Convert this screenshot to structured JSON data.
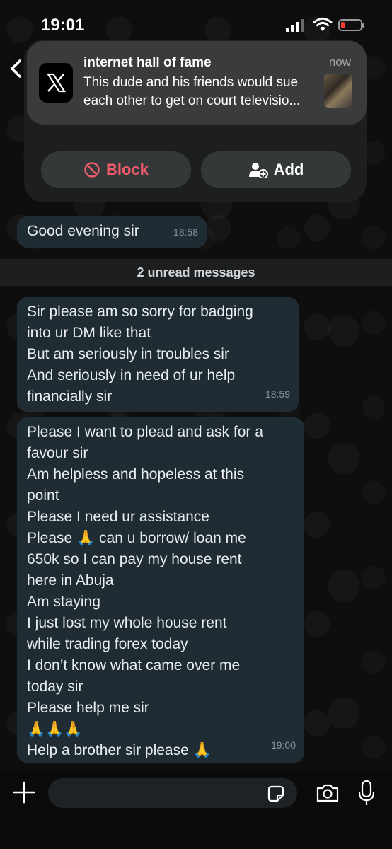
{
  "status_bar": {
    "time": "19:01",
    "battery_color": "#ff3b30"
  },
  "notification": {
    "app_icon": "x-logo-icon",
    "title": "internet hall of fame",
    "time": "now",
    "body_lines": [
      "This dude and his friends would sue",
      "each other to get on court televisio..."
    ]
  },
  "contact_actions": {
    "block_label": "Block",
    "add_label": "Add"
  },
  "messages": [
    {
      "lines": [
        "Good evening sir"
      ],
      "time": "18:58"
    },
    {
      "lines": [
        "Sir please am so sorry for badging",
        "into ur DM like that",
        "But am seriously in troubles sir",
        "And seriously in need of ur help",
        "financially sir"
      ],
      "time": "18:59"
    },
    {
      "lines": [
        "Please I want to plead and ask for a",
        "favour sir",
        "Am helpless and hopeless at this",
        "point",
        "Please I need ur assistance",
        "Please 🙏 can u borrow/ loan me",
        "650k so I can pay my house rent",
        "here in Abuja",
        "Am staying",
        "I just lost my whole house rent",
        "while trading forex today",
        "I don’t know what came over me",
        "today sir",
        "Please help me sir",
        "🙏🙏🙏",
        "Help a brother sir please 🙏"
      ],
      "time": "19:00"
    }
  ],
  "unread_banner": "2 unread messages",
  "input": {
    "value": "",
    "placeholder": ""
  },
  "colors": {
    "bubble": "#202c33",
    "block_red": "#f15c6d",
    "background": "#0b0b0b"
  }
}
